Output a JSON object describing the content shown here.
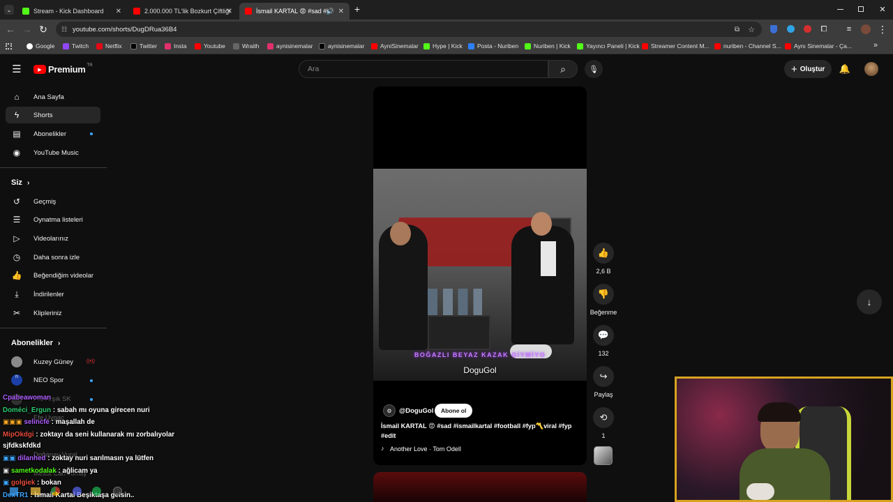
{
  "browser": {
    "tabs": [
      {
        "label": "Stream - Kick Dashboard",
        "color": "#53fc18"
      },
      {
        "label": "2.000.000 TL'lik Bozkurt Çiftliği",
        "color": "#ff0000"
      },
      {
        "label": "İsmail KARTAL 😡 #sad #is",
        "color": "#ff0000"
      }
    ],
    "new_tab": "+",
    "url": "youtube.com/shorts/DugDRua36B4",
    "bookmarks": [
      "Google",
      "Twitch",
      "Netflix",
      "Twitter",
      "Insta",
      "Youtube",
      "Wraith",
      "aynisinemalar",
      "aynisinemalar",
      "AyniSinemalar",
      "Hype | Kick",
      "Posta - Nuriben",
      "Nuriben | Kick",
      "Yayıncı Paneli | Kick",
      "Streamer Content M...",
      "nuriben - Channel S...",
      "Aynı Sinemalar - Ça..."
    ],
    "more_bookmarks": "»"
  },
  "yt": {
    "logo": "Premium",
    "region": "TR",
    "search_placeholder": "Ara",
    "create_label": "Oluştur",
    "sidebar_top": [
      "Ana Sayfa",
      "Shorts",
      "Abonelikler",
      "YouTube Music"
    ],
    "you_heading": "Siz",
    "you_items": [
      "Geçmiş",
      "Oynatma listeleri",
      "Videolarınız",
      "Daha sonra izle",
      "Beğendiğim videolar",
      "İndirilenler",
      "Klipleriniz"
    ],
    "subs_heading": "Abonelikler",
    "subs_items": [
      "Kuzey Güney",
      "NEO Spor"
    ],
    "short": {
      "caption_top": "BOĞAZLI BEYAZ KAZAK GİYMİYO",
      "watermark": "DoguGol",
      "channel": "@DoguGol",
      "subscribe": "Abone ol",
      "title": "İsmail KARTAL 😡 #sad #ismailkartal #football #fyp〽️viral #fyp",
      "title2": "#edit",
      "music": "Another Love · Tom Odell"
    },
    "actions": {
      "likes": "2,6 B",
      "dislike": "Beğenme",
      "comments": "132",
      "share": "Paylaş",
      "remix": "1"
    }
  },
  "chat": [
    {
      "user": "Cpabeawoman",
      "text": "",
      "color": "#b060ff"
    },
    {
      "user": "Doméci_Ergun",
      "text": " : sabah mı oyuna girecen nuri",
      "color": "#2ecc71"
    },
    {
      "user": "selincfe",
      "text": " : maşallah de",
      "color": "#b060ff"
    },
    {
      "user": "MipOkdgi",
      "text": " : zoktayı da seni kullanarak mı zorbalıyolar",
      "color": "#e74c3c"
    },
    {
      "user": "",
      "text": "sjfdkskfdkd",
      "color": "#ffffff"
    },
    {
      "user": "dilanhed",
      "text": " : zoktay nuri sarılmasın ya lütfen",
      "color": "#b060ff"
    },
    {
      "user": "sametkodalak",
      "text": " : ağlicam ya",
      "color": "#53fc18"
    },
    {
      "user": "golgiek",
      "text": " : bokan",
      "color": "#e74c3c"
    },
    {
      "user": "DexTR1",
      "text": " : İsmail Kartal Beşiktaşa gelsin..",
      "color": "#3ea6ff"
    }
  ],
  "ghost_sidebar": [
    "Pro Arşık SK",
    "Efe Uygaç",
    "Doğanay Vural",
    "Mesut Can Tomay"
  ],
  "colors": {
    "accent": "#ff0000",
    "bg": "#0f0f0f",
    "kick": "#53fc18",
    "webcam_border": "#d8a420"
  }
}
